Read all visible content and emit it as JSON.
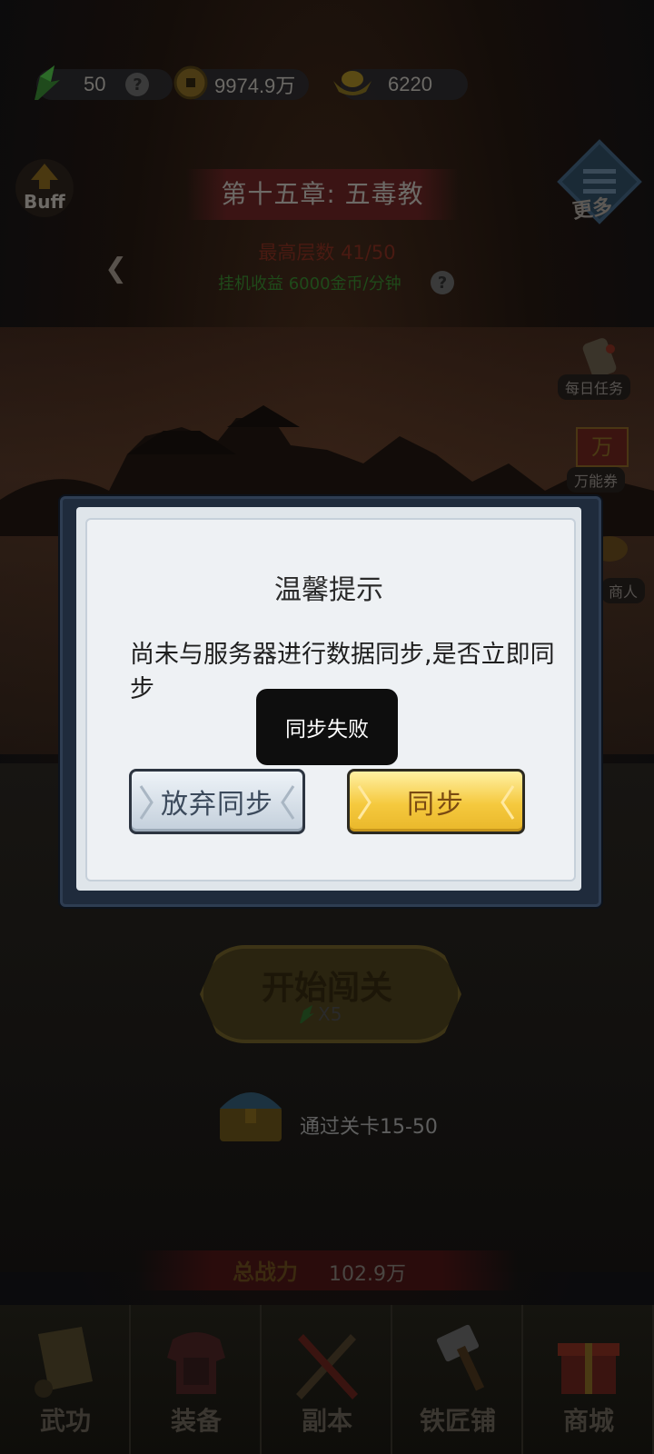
{
  "resources": {
    "stamina": {
      "value": "50",
      "icon": "jade-stamina-icon"
    },
    "coins": {
      "value": "9974.9万",
      "icon": "copper-coin-icon"
    },
    "ingots": {
      "value": "6220",
      "icon": "gold-ingot-icon"
    }
  },
  "hud": {
    "buff_label": "Buff",
    "more_label": "更多",
    "chapter_title": "第十五章: 五毒教",
    "best_floor": "最高层数 41/50",
    "afk_income": "挂机收益 6000金币/分钟",
    "help_glyph": "?"
  },
  "side_menu": {
    "daily_tasks": "每日任务",
    "universal_ticket": "万能券",
    "ticket_char": "万",
    "merchant": "商人"
  },
  "main": {
    "start_button": "开始闯关",
    "start_cost": "X5",
    "chest_text": "通过关卡15-50",
    "power_title": "总战力",
    "power_value": "102.9万"
  },
  "nav": [
    {
      "label": "武功",
      "icon": "scroll-icon"
    },
    {
      "label": "装备",
      "icon": "armor-icon"
    },
    {
      "label": "副本",
      "icon": "crossed-swords-icon"
    },
    {
      "label": "铁匠铺",
      "icon": "hammer-icon"
    },
    {
      "label": "商城",
      "icon": "gift-shop-icon"
    }
  ],
  "dialog": {
    "title": "温馨提示",
    "message": "尚未与服务器进行数据同步,是否立即同步",
    "cancel_label": "放弃同步",
    "confirm_label": "同步"
  },
  "toast": {
    "text": "同步失败"
  },
  "colors": {
    "confirm_gold": "#f5c93e",
    "cancel_silver": "#c3cfdb",
    "modal_frame": "#1f2b3c"
  }
}
